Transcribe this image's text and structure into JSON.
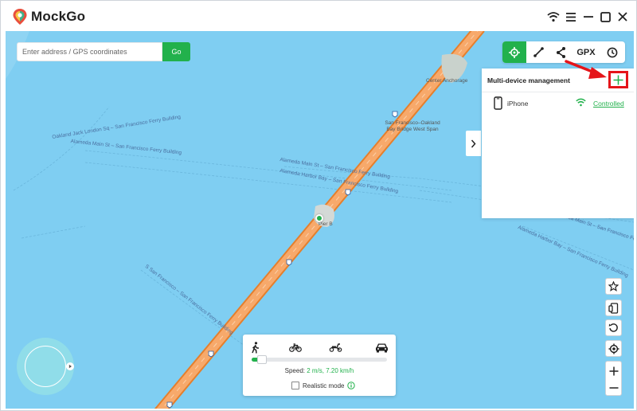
{
  "app": {
    "title": "MockGo"
  },
  "search": {
    "placeholder": "Enter address / GPS coordinates",
    "go_label": "Go"
  },
  "toolbar": {
    "gpx_label": "GPX"
  },
  "multi_device": {
    "title": "Multi-device management",
    "devices": [
      {
        "name": "iPhone",
        "status": "Controlled"
      }
    ]
  },
  "map": {
    "labels": [
      "Oakland Jack London Sq – San Francisco Ferry Building",
      "Alameda Main St – San Francisco Ferry Building",
      "Alameda Main St – San Francisco Ferry Building",
      "Alameda Harbor Bay – San Francisco Ferry Building",
      "S San Francisco – San Francisco Ferry Building",
      "Alameda Harbor Bay – San Francisco Ferry Building",
      "Alameda Main St – San Francisco Ferry Building"
    ],
    "poi": {
      "center_anchorage": "Center Anchorage",
      "bay_bridge": "San Francisco–Oakland Bay Bridge West Span",
      "pier": "Pier B"
    },
    "highway_shield": "80"
  },
  "speed": {
    "prefix": "Speed: ",
    "value": "2 m/s, 7.20 km/h",
    "level": 0.06,
    "realistic_label": "Realistic mode",
    "realistic_checked": false,
    "active_mode": "walk"
  },
  "colors": {
    "accent": "#22b14c",
    "water": "#7fcef2",
    "highway": "#f5a05a",
    "highlight_box": "#e5151a"
  },
  "icons": {
    "window_controls": [
      "wifi-icon",
      "menu-icon",
      "minimize-icon",
      "maximize-icon",
      "close-icon"
    ],
    "toolbar": [
      "teleport-crosshair-icon",
      "two-spot-route-icon",
      "multi-spot-route-icon",
      "gpx-import",
      "history-clock-icon"
    ],
    "side": [
      "favorite-star-icon",
      "device-mirror-icon",
      "reset-rotate-icon",
      "locate-target-icon",
      "zoom-in-icon",
      "zoom-out-icon"
    ],
    "modes": [
      "walk-icon",
      "bicycle-icon",
      "scooter-icon",
      "car-icon"
    ]
  }
}
